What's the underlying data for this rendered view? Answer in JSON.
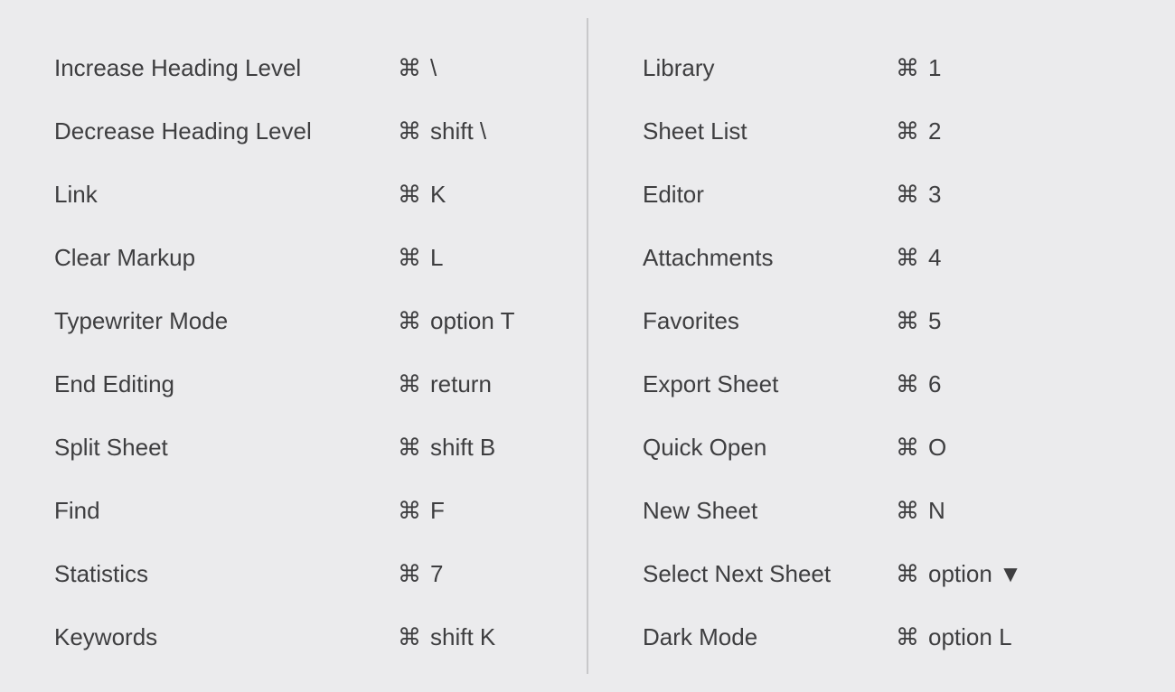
{
  "cmd_symbol": "⌘",
  "triangle_down": "▼",
  "left": [
    {
      "label": "Increase Heading Level",
      "keys": "\\"
    },
    {
      "label": "Decrease Heading Level",
      "keys": "shift \\"
    },
    {
      "label": "Link",
      "keys": "K"
    },
    {
      "label": "Clear Markup",
      "keys": "L"
    },
    {
      "label": "Typewriter Mode",
      "keys": "option T"
    },
    {
      "label": "End Editing",
      "keys": "return"
    },
    {
      "label": "Split Sheet",
      "keys": "shift B"
    },
    {
      "label": "Find",
      "keys": "F"
    },
    {
      "label": "Statistics",
      "keys": "7"
    },
    {
      "label": "Keywords",
      "keys": "shift K"
    }
  ],
  "right": [
    {
      "label": "Library",
      "keys": "1"
    },
    {
      "label": "Sheet List",
      "keys": "2"
    },
    {
      "label": "Editor",
      "keys": "3"
    },
    {
      "label": "Attachments",
      "keys": "4"
    },
    {
      "label": "Favorites",
      "keys": "5"
    },
    {
      "label": "Export Sheet",
      "keys": "6"
    },
    {
      "label": "Quick Open",
      "keys": "O"
    },
    {
      "label": "New Sheet",
      "keys": "N"
    },
    {
      "label": "Select Next Sheet",
      "keys": "option ▼"
    },
    {
      "label": "Dark Mode",
      "keys": "option L"
    }
  ]
}
